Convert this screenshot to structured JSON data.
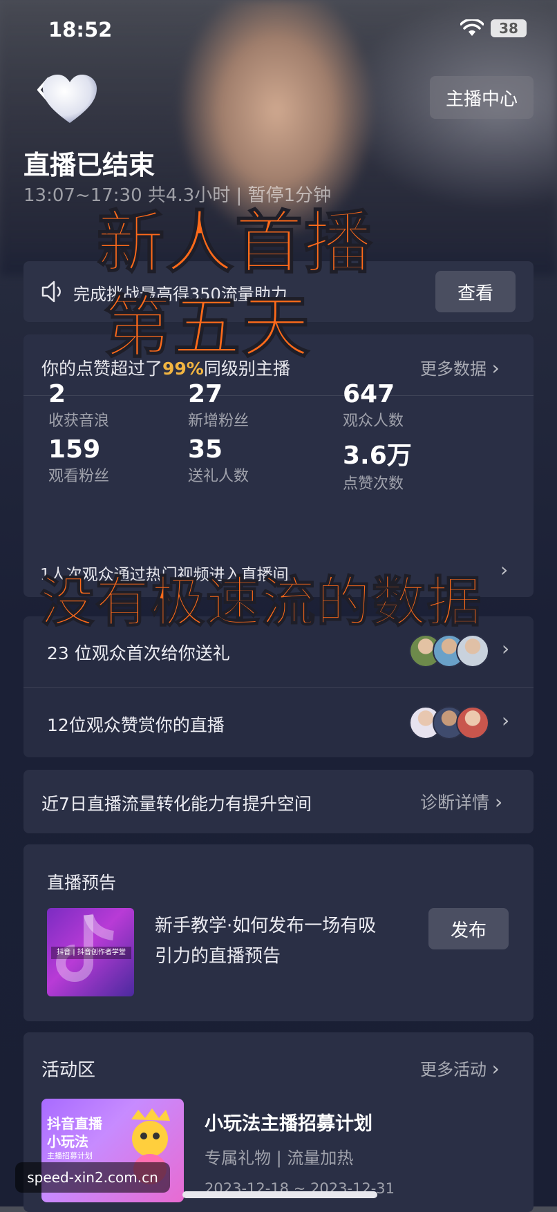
{
  "status_bar": {
    "time": "18:52",
    "battery": "38"
  },
  "header": {
    "host_center_label": "主播中心",
    "title": "直播已结束",
    "subtitle": "13:07~17:30 共4.3小时 | 暂停1分钟"
  },
  "challenge": {
    "text": "完成挑战最高得350流量助力",
    "button": "查看"
  },
  "stats": {
    "likes_prefix": "你的点赞超过了",
    "likes_percent": "99%",
    "likes_suffix": "同级别主播",
    "more_data": "更多数据",
    "items": [
      {
        "value": "2",
        "label": "收获音浪"
      },
      {
        "value": "27",
        "label": "新增粉丝"
      },
      {
        "value": "647",
        "label": "观众人数"
      },
      {
        "value": "159",
        "label": "观看粉丝"
      },
      {
        "value": "35",
        "label": "送礼人数"
      },
      {
        "value": "3.6万",
        "label": "点赞次数"
      }
    ],
    "hot_text": "1人次观众通过热门视频进入直播间"
  },
  "gifts": {
    "first_gift": "23 位观众首次给你送礼",
    "appreciate": "12位观众赞赏你的直播"
  },
  "diagnosis": {
    "text": "近7日直播流量转化能力有提升空间",
    "link": "诊断详情"
  },
  "preview": {
    "title": "直播预告",
    "desc_line1": "新手教学·如何发布一场有吸",
    "desc_line2": "引力的直播预告",
    "thumb_label": "抖音 | 抖音创作者学堂",
    "button": "发布"
  },
  "activity": {
    "title": "活动区",
    "more": "更多活动",
    "item_title": "小玩法主播招募计划",
    "item_tags": "专属礼物 | 流量加热",
    "item_dates": "2023-12-18 ~ 2023-12-31",
    "thumb_line1": "抖音直播",
    "thumb_line2": "小玩法",
    "thumb_line3": "主播招募计划"
  },
  "overlay": {
    "line1": "新人首播",
    "line2": "第五天",
    "line3": "没有极速流的数据"
  },
  "watermark": "speed-xin2.com.cn",
  "colors": {
    "overlay_orange": "#ff6a1a",
    "highlight_gold": "#f2b541",
    "card_bg": "#2a2f45"
  }
}
